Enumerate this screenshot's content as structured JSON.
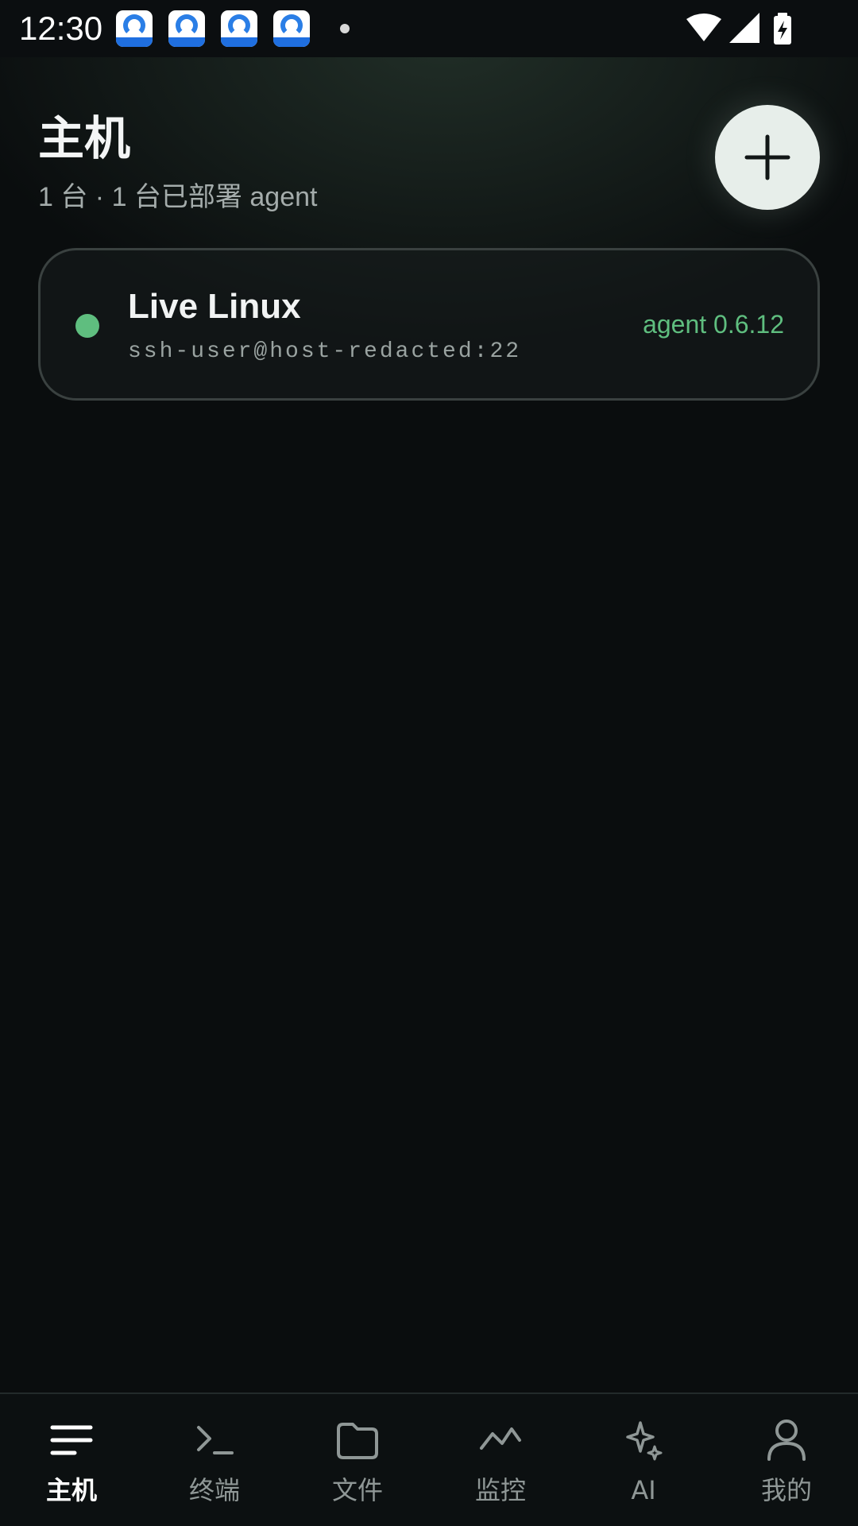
{
  "status_bar": {
    "time": "12:30",
    "notification_icons": [
      "ai-app-icon",
      "ai-app-icon",
      "ai-app-icon",
      "ai-app-icon"
    ],
    "system_icons": [
      "wifi-icon",
      "signal-icon",
      "battery-charging-icon"
    ]
  },
  "header": {
    "title": "主机",
    "subtitle": "1 台 · 1 台已部署 agent",
    "add_button_icon": "plus-icon"
  },
  "hosts": [
    {
      "name": "Live Linux",
      "address": "ssh-user@host-redacted:22",
      "agent": "agent 0.6.12",
      "status": "online",
      "status_color": "#5fbe7f"
    }
  ],
  "nav": {
    "active": "主机",
    "items": [
      {
        "label": "主机",
        "icon": "hosts-menu-icon"
      },
      {
        "label": "终端",
        "icon": "terminal-icon"
      },
      {
        "label": "文件",
        "icon": "folder-icon"
      },
      {
        "label": "监控",
        "icon": "monitor-chart-icon"
      },
      {
        "label": "AI",
        "icon": "sparkle-icon"
      },
      {
        "label": "我的",
        "icon": "profile-icon"
      }
    ]
  },
  "colors": {
    "background": "#0a0d0e",
    "accent_green": "#5fbe7f",
    "fab_background": "#e7eeea"
  }
}
